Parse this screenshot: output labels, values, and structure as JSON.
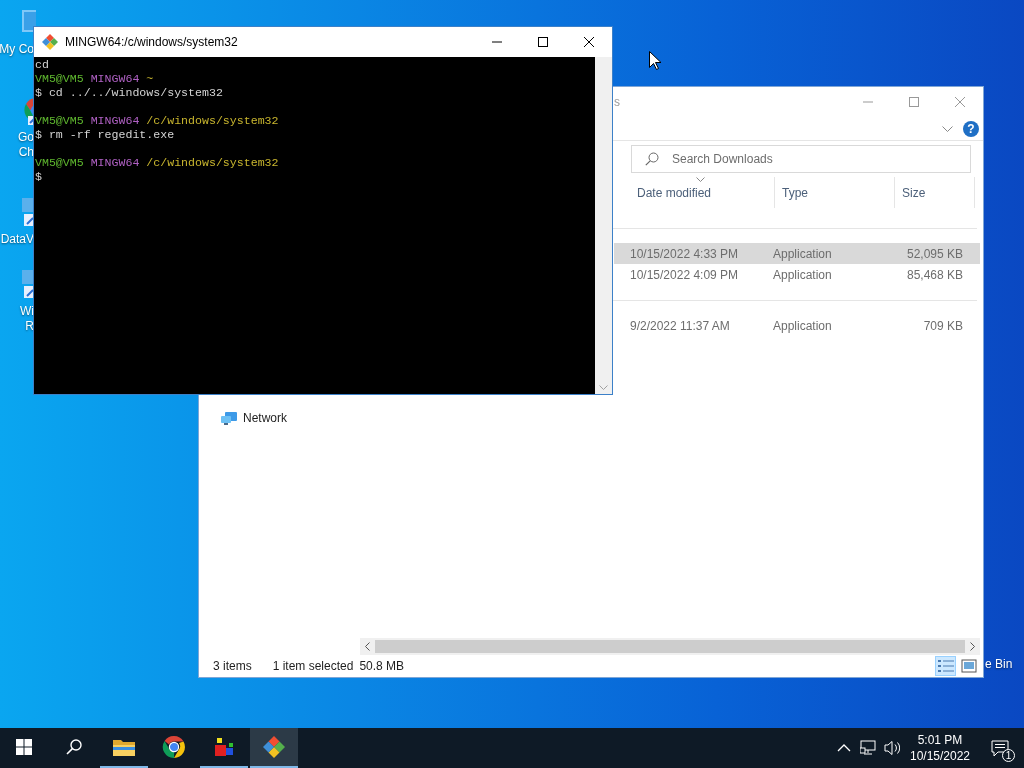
{
  "desktop": {
    "icons": [
      {
        "kind": "computer",
        "lines": [
          "My Co"
        ]
      },
      {
        "kind": "browser",
        "lines": [
          "Go",
          "Ch"
        ]
      },
      {
        "kind": "shortcut",
        "lines": [
          "DataV"
        ]
      },
      {
        "kind": "shortcut",
        "lines": [
          "Wi",
          "R"
        ]
      }
    ],
    "recycle_bin": {
      "label": "e Bin"
    }
  },
  "explorer": {
    "title": "s",
    "help_label": "?",
    "search": {
      "placeholder": "Search Downloads"
    },
    "columns": [
      {
        "label": "Date modified",
        "sorted": true
      },
      {
        "label": "Type",
        "sorted": false
      },
      {
        "label": "Size",
        "sorted": false
      }
    ],
    "groups": [
      {
        "rows": [
          {
            "date": "10/15/2022 4:33 PM",
            "type": "Application",
            "size": "52,095 KB",
            "selected": true
          },
          {
            "date": "10/15/2022 4:09 PM",
            "type": "Application",
            "size": "85,468 KB",
            "selected": false
          }
        ]
      },
      {
        "rows": [
          {
            "date": "9/2/2022 11:37 AM",
            "type": "Application",
            "size": "709 KB",
            "selected": false
          }
        ]
      }
    ],
    "nav_items": [
      {
        "label": "Network"
      }
    ],
    "status": {
      "count": "3 items",
      "selection": "1 item selected",
      "size": "50.8 MB"
    },
    "views": [
      {
        "kind": "details",
        "selected": true
      },
      {
        "kind": "large_icons",
        "selected": false
      }
    ]
  },
  "terminal": {
    "title": "MINGW64:/c/windows/system32",
    "lines": [
      {
        "kind": "text",
        "segments": [
          {
            "kind": "output",
            "text": "cd"
          }
        ]
      },
      {
        "kind": "text",
        "segments": [
          {
            "kind": "user",
            "text": "VM5@VM5"
          },
          {
            "kind": "host",
            "text": "MINGW64"
          },
          {
            "kind": "path",
            "text": "~"
          }
        ]
      },
      {
        "kind": "text",
        "segments": [
          {
            "kind": "output",
            "text": "$ cd ../../windows/system32"
          }
        ]
      },
      {
        "kind": "blank"
      },
      {
        "kind": "text",
        "segments": [
          {
            "kind": "user",
            "text": "VM5@VM5"
          },
          {
            "kind": "host",
            "text": "MINGW64"
          },
          {
            "kind": "path",
            "text": "/c/windows/system32"
          }
        ]
      },
      {
        "kind": "text",
        "segments": [
          {
            "kind": "output",
            "text": "$ rm -rf regedit.exe"
          }
        ]
      },
      {
        "kind": "blank"
      },
      {
        "kind": "text",
        "segments": [
          {
            "kind": "user",
            "text": "VM5@VM5"
          },
          {
            "kind": "host",
            "text": "MINGW64"
          },
          {
            "kind": "path",
            "text": "/c/windows/system32"
          }
        ]
      },
      {
        "kind": "text",
        "segments": [
          {
            "kind": "output",
            "text": "$"
          }
        ]
      }
    ]
  },
  "taskbar": {
    "apps": [
      {
        "kind": "folder",
        "running": true,
        "selected": false
      },
      {
        "kind": "browser",
        "running": false,
        "selected": false
      },
      {
        "kind": "blocks",
        "running": true,
        "selected": false
      },
      {
        "kind": "git",
        "running": true,
        "selected": true
      }
    ],
    "clock": {
      "time": "5:01 PM",
      "date": "10/15/2022"
    },
    "notification_count": "1"
  }
}
